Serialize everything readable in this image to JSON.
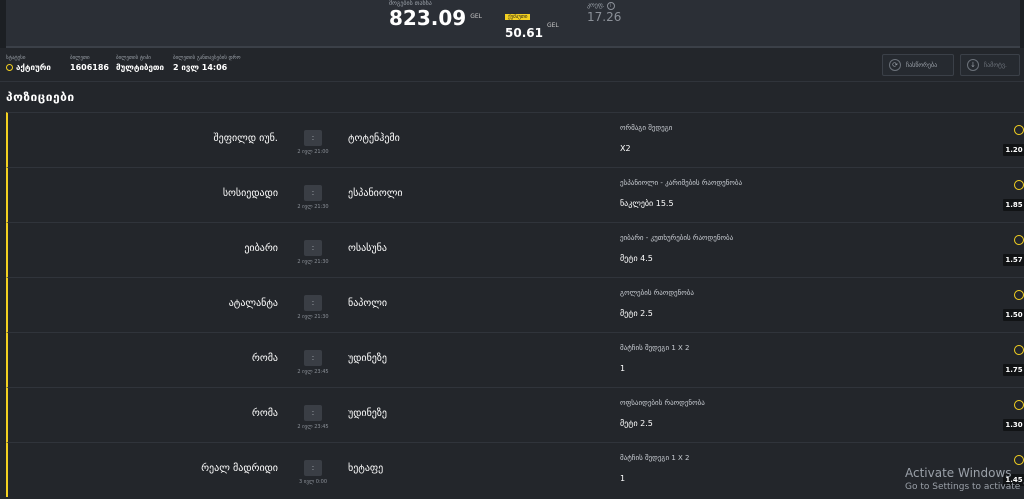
{
  "summary": {
    "possible_win_label": "მოგების თანხა",
    "possible_win_value": "823.09",
    "possible_win_currency": "GEL",
    "cashout_label": "ქეშაუთი",
    "cashout_value": "50.61",
    "cashout_currency": "GEL",
    "odds_label": "კოეფ.",
    "odds_value": "17.26"
  },
  "meta": {
    "status_label": "სტატუსი",
    "status_value": "აქტიური",
    "ticket_label": "ბილეთი",
    "ticket_value": "1606186",
    "type_label": "ბილეთის ტიპი",
    "type_value": "მულტიბეთი",
    "date_label": "ბილეთის განთავსების დრო",
    "date_value": "2 ივლ 14:06"
  },
  "actions": {
    "refresh_label": "ჩასწორება",
    "download_label": "ჩამოტვ."
  },
  "section_title": "პოზიციები",
  "positions": [
    {
      "home": "შეფილდ იუნ.",
      "away": "ტოტენჰემი",
      "score": ":",
      "time": "2 ივლ 21:00",
      "market": "ორმაგი შედეგი",
      "selection": "X2",
      "odd": "1.20"
    },
    {
      "home": "სოსიედადი",
      "away": "ესპანიოლი",
      "score": ":",
      "time": "2 ივლ 21:30",
      "market": "ესპანიოლი - კარიმების რაოდენობა",
      "selection": "ნაკლები 15.5",
      "odd": "1.85"
    },
    {
      "home": "ეიბარი",
      "away": "ოსასუნა",
      "score": ":",
      "time": "2 ივლ 21:30",
      "market": "ეიბარი - კუთხურების რაოდენობა",
      "selection": "მეტი 4.5",
      "odd": "1.57"
    },
    {
      "home": "ატალანტა",
      "away": "ნაპოლი",
      "score": ":",
      "time": "2 ივლ 21:30",
      "market": "გოლების რაოდენობა",
      "selection": "მეტი 2.5",
      "odd": "1.50"
    },
    {
      "home": "რომა",
      "away": "უდინეზე",
      "score": ":",
      "time": "2 ივლ 23:45",
      "market": "მატჩის შედეგი 1 X 2",
      "selection": "1",
      "odd": "1.75"
    },
    {
      "home": "რომა",
      "away": "უდინეზე",
      "score": ":",
      "time": "2 ივლ 23:45",
      "market": "ოფსაიდების რაოდენობა",
      "selection": "მეტი 2.5",
      "odd": "1.30"
    },
    {
      "home": "რეალ მადრიდი",
      "away": "ხეტაფე",
      "score": ":",
      "time": "3 ივლ 0:00",
      "market": "მატჩის შედეგი 1 X 2",
      "selection": "1",
      "odd": "1.45"
    }
  ],
  "watermark": {
    "line1": "Activate Windows",
    "line2": "Go to Settings to activate Wi"
  },
  "colors": {
    "accent": "#f3d020",
    "background": "#23262b",
    "panel": "#2b2f36"
  }
}
